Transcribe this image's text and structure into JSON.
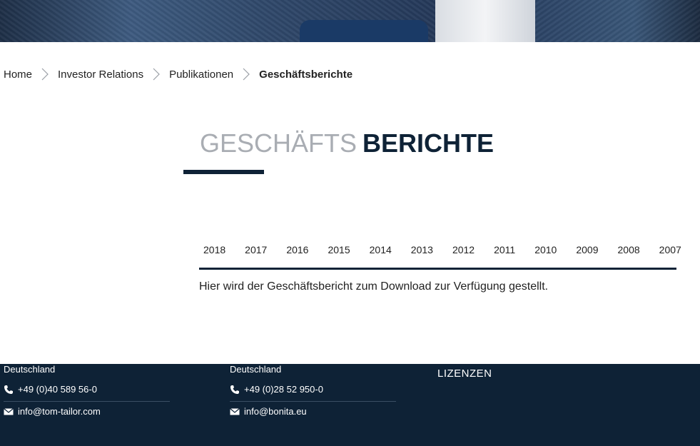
{
  "breadcrumb": {
    "items": [
      "Home",
      "Investor Relations",
      "Publikationen"
    ],
    "current": "Geschäftsberichte"
  },
  "title": {
    "light": "GESCHÄFTS",
    "bold": "BERICHTE"
  },
  "tabs": [
    "2018",
    "2017",
    "2016",
    "2015",
    "2014",
    "2013",
    "2012",
    "2011",
    "2010",
    "2009",
    "2008",
    "2007"
  ],
  "content": {
    "text": "Hier wird der Geschäftsbericht zum Download zur Verfügung gestellt."
  },
  "footer": {
    "col1": {
      "country": "Deutschland",
      "phone": "+49 (0)40 589 56-0",
      "email": "info@tom-tailor.com"
    },
    "col2": {
      "country": "Deutschland",
      "phone": "+49 (0)28 52 950-0",
      "email": "info@bonita.eu"
    },
    "lizenzen": "LIZENZEN"
  },
  "colors": {
    "navy": "#0e2236",
    "title_light": "#a9adb3"
  },
  "icons": [
    "chevron-right-icon",
    "phone-icon",
    "mail-icon"
  ]
}
